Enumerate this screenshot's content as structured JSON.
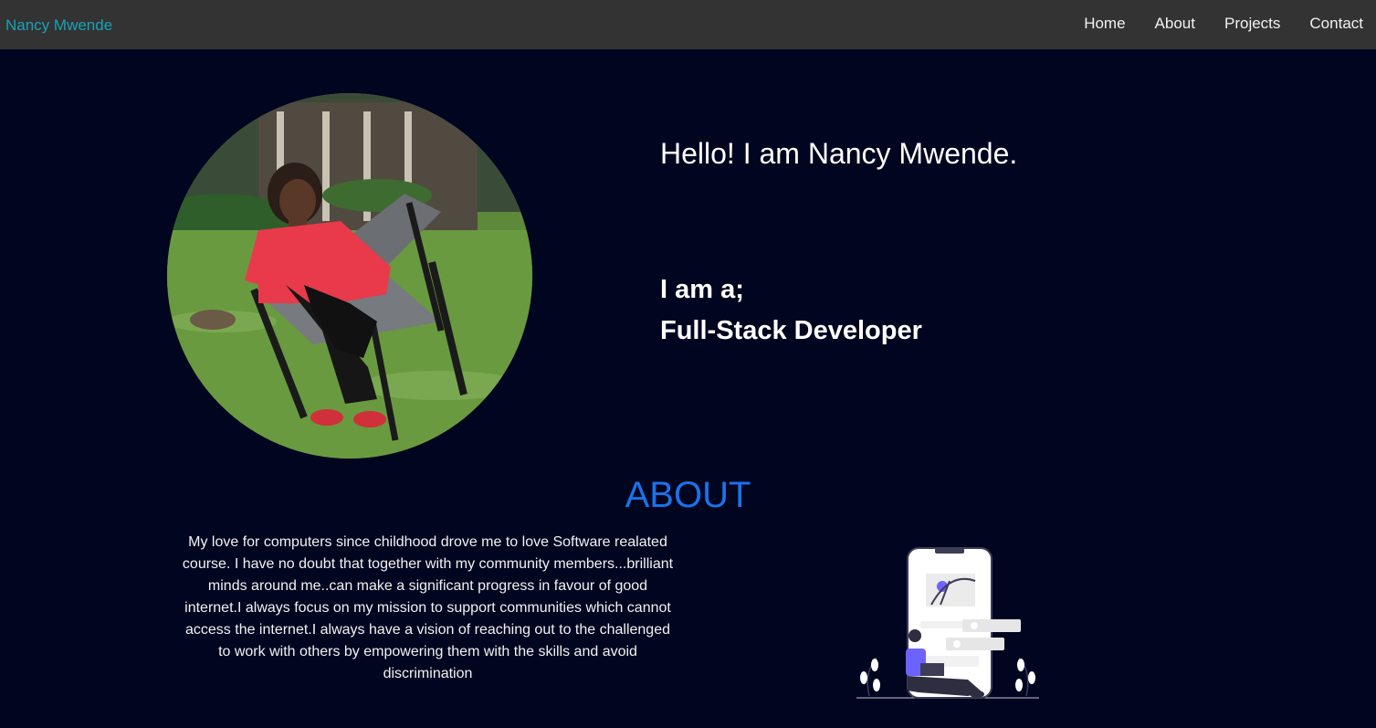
{
  "nav": {
    "brand": "Nancy Mwende",
    "links": [
      "Home",
      "About",
      "Projects",
      "Contact"
    ]
  },
  "hero": {
    "greeting": "Hello! I am Nancy Mwende.",
    "role_intro": "I am a;",
    "role": "Full-Stack Developer"
  },
  "about": {
    "heading": "ABOUT",
    "text": "My love for computers since childhood drove me to love Software realated course. I have no doubt that together with my community members...brilliant minds around me..can make a significant progress in favour of good internet.I always focus on my mission to support communities which cannot access the internet.I always have a vision of reaching out to the challenged to work with others by empowering them with the skills and avoid discrimination"
  },
  "colors": {
    "background": "#000520",
    "navbar": "#333333",
    "brand": "#17a2b8",
    "about_heading": "#1a73e8",
    "accent_illustration": "#6c63ff"
  }
}
